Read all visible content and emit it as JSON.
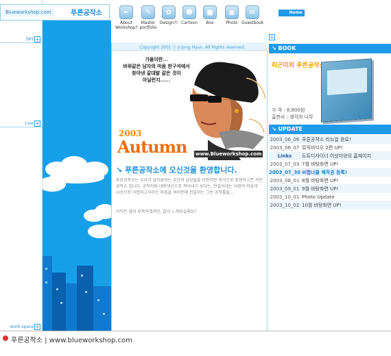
{
  "logo": {
    "url": "Blueworkshop.com",
    "kr": "푸른공작소"
  },
  "side": {
    "sky": "SKY",
    "live": "Live",
    "workspace": "work-space"
  },
  "nav": [
    {
      "label": "About Workshop?",
      "icon": "pen-icon"
    },
    {
      "label": "Master portfolio",
      "icon": "brush-icon"
    },
    {
      "label": "Design?!",
      "icon": "design-icon"
    },
    {
      "label": "Cartoon",
      "icon": "cartoon-icon"
    },
    {
      "label": "Box",
      "icon": "box-icon"
    },
    {
      "label": "Photo",
      "icon": "photo-icon"
    },
    {
      "label": "Guestbook",
      "icon": "guestbook-icon"
    }
  ],
  "center": {
    "copyright": "Copyright 2001 ⓒ Ji Jong Hyun. All Rights reserved.",
    "poem": "가을이란...\n바위같은 남자의 마음 한구석에서\n찾아낸 갈대발 같은 것이\n아닐런지......",
    "year": "2003",
    "season": "Autumn",
    "url": "www.Blueworkshop.com",
    "welcome": "푸른공작소에 오신것을 환영합니다.",
    "intro": "푸른공작소는 우리가 살아숨쉬는 공간의 일상들을 이런저런 방식으로 표현하고픈 작은 공작소 입니다. 공작처럼 대량생산으로 찍어내기 보다는, 만들어내는 사람의 마음과 시선으로 어렵하고자하는 마음을 여러분께 전달하는 그런 공작툴들....",
    "intro2": "아직은 많이 부족하겠지만, 같이 느껴보실래요?"
  },
  "right": {
    "home": "Home",
    "book_header": "BOOK",
    "book_title": "피곤미피 푸른공작소",
    "book_price": "가   격 : 8,800원",
    "book_pub": "출판사 : 생각의 나무",
    "update_header": "UPDATE",
    "updates": [
      {
        "date": "2003_06_06",
        "text": "푸른공작소 리뉴얼 완료!"
      },
      {
        "date": "2003_06_07",
        "text": "뮤직비디오 2편 UP!"
      },
      {
        "date": "Links",
        "text": "도트디자이너 이성미양의 홈페이지"
      },
      {
        "date": "2003_07_03",
        "text": "7월 바탕화면 UP!"
      },
      {
        "date": "2003_07_30",
        "text": "씨랩너클 제작권 등록!"
      },
      {
        "date": "2003_08_01",
        "text": "8월 바탕화면 UP!"
      },
      {
        "date": "2003_09_01",
        "text": "9월 바탕화면 UP!"
      },
      {
        "date": "2003_10_01",
        "text": "Photo Update"
      },
      {
        "date": "2003_10_02",
        "text": "10월 바탕화면 UP!"
      }
    ]
  },
  "footer": "푸른공작소 | www.blueworkshop.com"
}
